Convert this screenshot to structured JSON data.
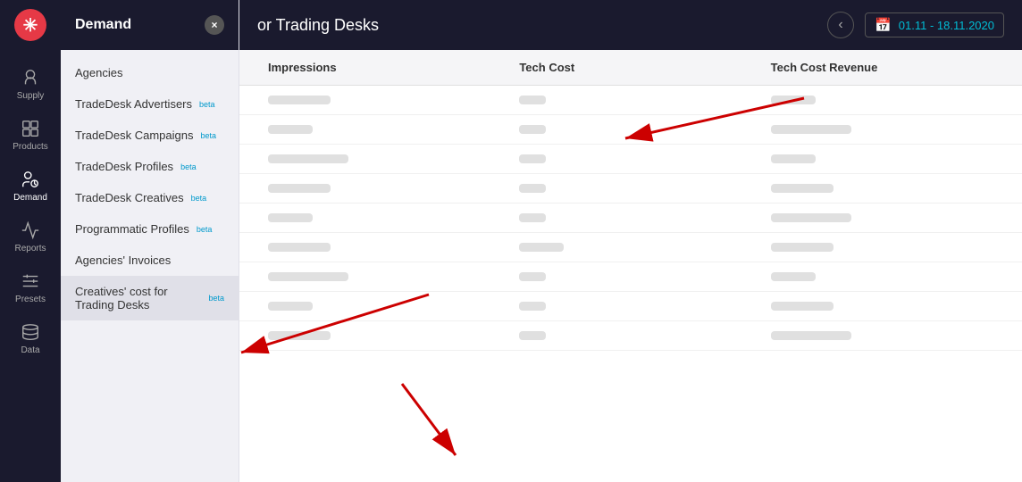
{
  "app": {
    "logo": "✳",
    "title": "Creatives' cost for Trading Desks"
  },
  "nav": {
    "items": [
      {
        "id": "supply",
        "label": "Supply",
        "icon": "supply"
      },
      {
        "id": "products",
        "label": "Products",
        "icon": "products"
      },
      {
        "id": "demand",
        "label": "Demand",
        "icon": "demand",
        "active": true
      },
      {
        "id": "reports",
        "label": "Reports",
        "icon": "reports"
      },
      {
        "id": "presets",
        "label": "Presets",
        "icon": "presets"
      },
      {
        "id": "data",
        "label": "Data",
        "icon": "data"
      }
    ]
  },
  "sidebar": {
    "title": "Demand",
    "close_label": "×",
    "items": [
      {
        "id": "agencies",
        "label": "Agencies",
        "beta": false
      },
      {
        "id": "tradedesk-advertisers",
        "label": "TradeDesk Advertisers",
        "beta": true
      },
      {
        "id": "tradedesk-campaigns",
        "label": "TradeDesk Campaigns",
        "beta": true
      },
      {
        "id": "tradedesk-profiles",
        "label": "TradeDesk Profiles",
        "beta": true
      },
      {
        "id": "tradedesk-creatives",
        "label": "TradeDesk Creatives",
        "beta": true
      },
      {
        "id": "programmatic-profiles",
        "label": "Programmatic Profiles",
        "beta": true
      },
      {
        "id": "agencies-invoices",
        "label": "Agencies' Invoices",
        "beta": false
      },
      {
        "id": "creatives-cost",
        "label": "Creatives' cost for Trading Desks",
        "beta": true,
        "active": true
      }
    ]
  },
  "topbar": {
    "title": "or Trading Desks",
    "date_range": "01.11 - 18.11.2020",
    "back_label": "‹"
  },
  "table": {
    "columns": [
      "Impressions",
      "Tech Cost",
      "Tech Cost Revenue"
    ],
    "rows": [
      {
        "col1_size": "lg",
        "col2_size": "sm",
        "col3_size": "md"
      },
      {
        "col1_size": "md",
        "col2_size": "sm",
        "col3_size": "xl"
      },
      {
        "col1_size": "xl",
        "col2_size": "sm",
        "col3_size": "md"
      },
      {
        "col1_size": "lg",
        "col2_size": "sm",
        "col3_size": "lg"
      },
      {
        "col1_size": "md",
        "col2_size": "sm",
        "col3_size": "xl"
      },
      {
        "col1_size": "lg",
        "col2_size": "md",
        "col3_size": "lg"
      },
      {
        "col1_size": "xl",
        "col2_size": "sm",
        "col3_size": "md"
      },
      {
        "col1_size": "md",
        "col2_size": "sm",
        "col3_size": "lg"
      },
      {
        "col1_size": "lg",
        "col2_size": "sm",
        "col3_size": "xl"
      }
    ]
  }
}
